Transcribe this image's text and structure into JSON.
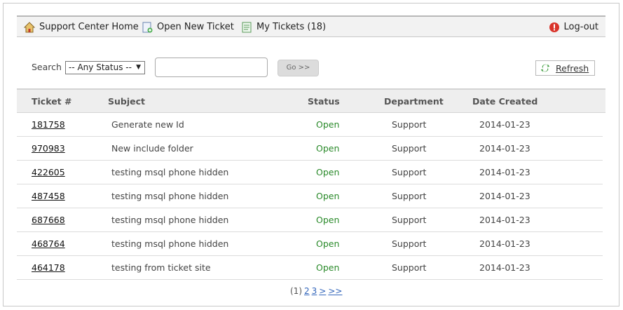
{
  "nav": {
    "home": {
      "label": "Support Center Home",
      "icon": "home-icon"
    },
    "open_ticket": {
      "label": "Open New Ticket",
      "icon": "new-ticket-icon"
    },
    "my_tickets": {
      "label": "My Tickets (18)",
      "icon": "tickets-icon"
    },
    "logout": {
      "label": "Log-out",
      "icon": "logout-icon"
    }
  },
  "search": {
    "label": "Search",
    "status_selected": "-- Any Status --",
    "query_value": "",
    "go_label": "Go >>"
  },
  "refresh_label": "Refresh",
  "table": {
    "headers": [
      "Ticket #",
      "Subject",
      "Status",
      "Department",
      "Date Created"
    ],
    "rows": [
      [
        "181758",
        "Generate new Id",
        "Open",
        "Support",
        "2014-01-23"
      ],
      [
        "970983",
        "New include folder",
        "Open",
        "Support",
        "2014-01-23"
      ],
      [
        "422605",
        "testing msql phone hidden",
        "Open",
        "Support",
        "2014-01-23"
      ],
      [
        "487458",
        "testing msql phone hidden",
        "Open",
        "Support",
        "2014-01-23"
      ],
      [
        "687668",
        "testing msql phone hidden",
        "Open",
        "Support",
        "2014-01-23"
      ],
      [
        "468764",
        "testing msql phone hidden",
        "Open",
        "Support",
        "2014-01-23"
      ],
      [
        "464178",
        "testing from ticket site",
        "Open",
        "Support",
        "2014-01-23"
      ]
    ]
  },
  "pagination": {
    "current": "(1)",
    "pages": [
      "2",
      "3"
    ],
    "next": ">",
    "last": ">>"
  },
  "colors": {
    "status_open": "#2a8a2a",
    "link": "#3366bb"
  }
}
